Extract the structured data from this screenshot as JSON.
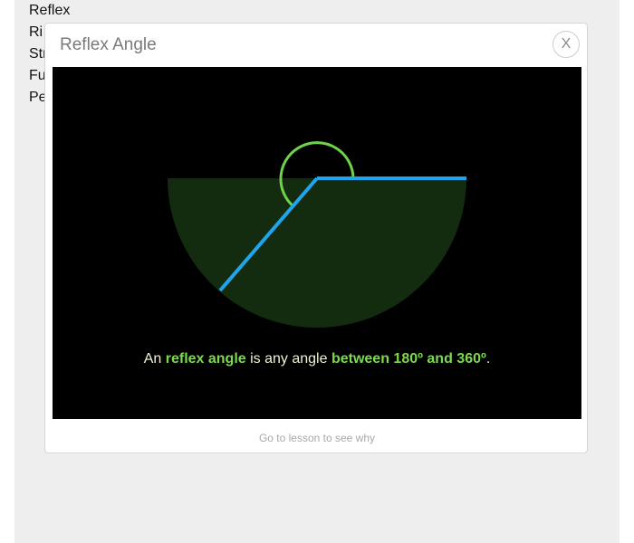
{
  "background_list": [
    "Reflex",
    "Ri",
    "Str",
    "Fu",
    "Pe"
  ],
  "modal": {
    "title": "Reflex Angle",
    "close_label": "X",
    "caption": {
      "part1": "An ",
      "highlight1": "reflex angle",
      "part2": " is any angle ",
      "highlight2": "between 180º and 360º",
      "part3": "."
    },
    "footer_link": "Go to lesson to see why"
  },
  "colors": {
    "sector_fill": "#132c10",
    "angle_arc": "#6fd34a",
    "rays": "#1ea5ee",
    "highlight_text": "#7bd94f",
    "caption_text": "#f1f1d2"
  }
}
